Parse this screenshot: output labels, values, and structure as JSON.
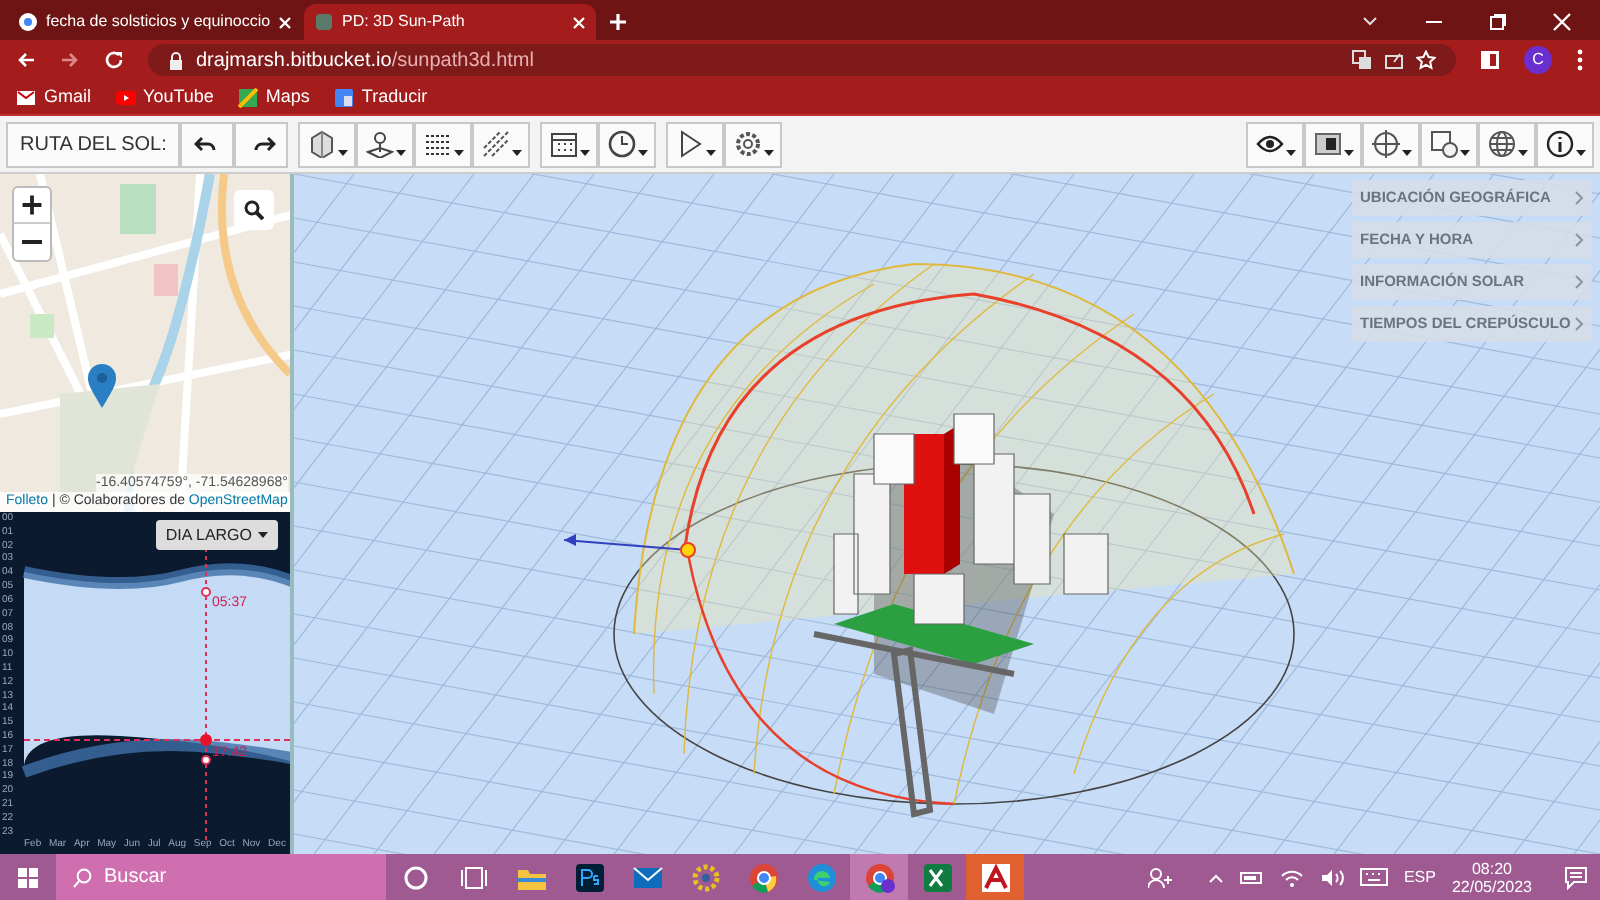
{
  "browser": {
    "tabs": [
      {
        "title": "fecha de solsticios y equinoccio",
        "selected": false
      },
      {
        "title": "PD: 3D Sun-Path",
        "selected": true
      }
    ],
    "url_host": "drajmarsh.bitbucket.io",
    "url_path": "/sunpath3d.html",
    "profile_initial": "C",
    "bookmarks": [
      {
        "kind": "gmail",
        "label": "Gmail"
      },
      {
        "kind": "youtube",
        "label": "YouTube"
      },
      {
        "kind": "maps",
        "label": "Maps"
      },
      {
        "kind": "translate",
        "label": "Traducir"
      }
    ]
  },
  "app_toolbar": {
    "label": "RUTA DEL SOL:",
    "left_buttons": [
      {
        "kind": "undo"
      },
      {
        "kind": "redo"
      },
      {
        "kind": "cube"
      },
      {
        "kind": "pin"
      },
      {
        "kind": "grid"
      },
      {
        "kind": "lines"
      },
      {
        "kind": "calendar"
      },
      {
        "kind": "clock"
      },
      {
        "kind": "play"
      },
      {
        "kind": "gear"
      }
    ],
    "right_buttons": [
      {
        "kind": "eye"
      },
      {
        "kind": "split"
      },
      {
        "kind": "crosshair"
      },
      {
        "kind": "calclock"
      },
      {
        "kind": "globe"
      },
      {
        "kind": "info"
      }
    ]
  },
  "map": {
    "coordinates": "-16.40574759°, -71.54628968°",
    "attribution_link": "Folleto",
    "attribution_sep": " | © Colaboradores de ",
    "attribution_osm": "OpenStreetMap"
  },
  "day_chart": {
    "dropdown": "DIA LARGO",
    "hours": [
      "00",
      "01",
      "02",
      "03",
      "04",
      "05",
      "06",
      "07",
      "08",
      "09",
      "10",
      "11",
      "12",
      "13",
      "14",
      "15",
      "16",
      "17",
      "18",
      "19",
      "20",
      "21",
      "22",
      "23"
    ],
    "months": [
      "Feb",
      "Mar",
      "Apr",
      "May",
      "Jun",
      "Jul",
      "Aug",
      "Sep",
      "Oct",
      "Nov",
      "Dec"
    ],
    "sunrise": "05:37",
    "sunset": "17:42"
  },
  "side_panel": [
    {
      "label": "UBICACIÓN GEOGRÁFICA"
    },
    {
      "label": "FECHA Y HORA"
    },
    {
      "label": "INFORMACIÓN SOLAR"
    },
    {
      "label": "TIEMPOS DEL CREPÚSCULO"
    }
  ],
  "taskbar": {
    "search_placeholder": "Buscar",
    "apps": [
      {
        "kind": "cortana"
      },
      {
        "kind": "taskview"
      },
      {
        "kind": "folder"
      },
      {
        "kind": "ps"
      },
      {
        "kind": "mail"
      },
      {
        "kind": "gear"
      },
      {
        "kind": "chrome"
      },
      {
        "kind": "edge"
      },
      {
        "kind": "chrome2"
      },
      {
        "kind": "excel"
      },
      {
        "kind": "acad"
      }
    ],
    "language": "ESP",
    "time": "08:20",
    "date": "22/05/2023"
  }
}
